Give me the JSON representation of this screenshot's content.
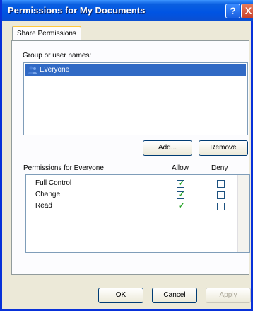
{
  "window": {
    "title": "Permissions for My Documents",
    "help_glyph": "?",
    "close_glyph": "X"
  },
  "tabs": [
    {
      "label": "Share Permissions"
    }
  ],
  "groups": {
    "label": "Group or user names:",
    "items": [
      {
        "name": "Everyone",
        "icon": "users-icon"
      }
    ]
  },
  "buttons": {
    "add": "Add...",
    "remove": "Remove",
    "ok": "OK",
    "cancel": "Cancel",
    "apply": "Apply"
  },
  "permissions": {
    "label": "Permissions for Everyone",
    "allow_header": "Allow",
    "deny_header": "Deny",
    "rows": [
      {
        "name": "Full Control",
        "allow": true,
        "deny": false
      },
      {
        "name": "Change",
        "allow": true,
        "deny": false
      },
      {
        "name": "Read",
        "allow": true,
        "deny": false
      }
    ]
  },
  "colors": {
    "accent": "#0054e3",
    "selection": "#316ac5",
    "check": "#21a121"
  }
}
